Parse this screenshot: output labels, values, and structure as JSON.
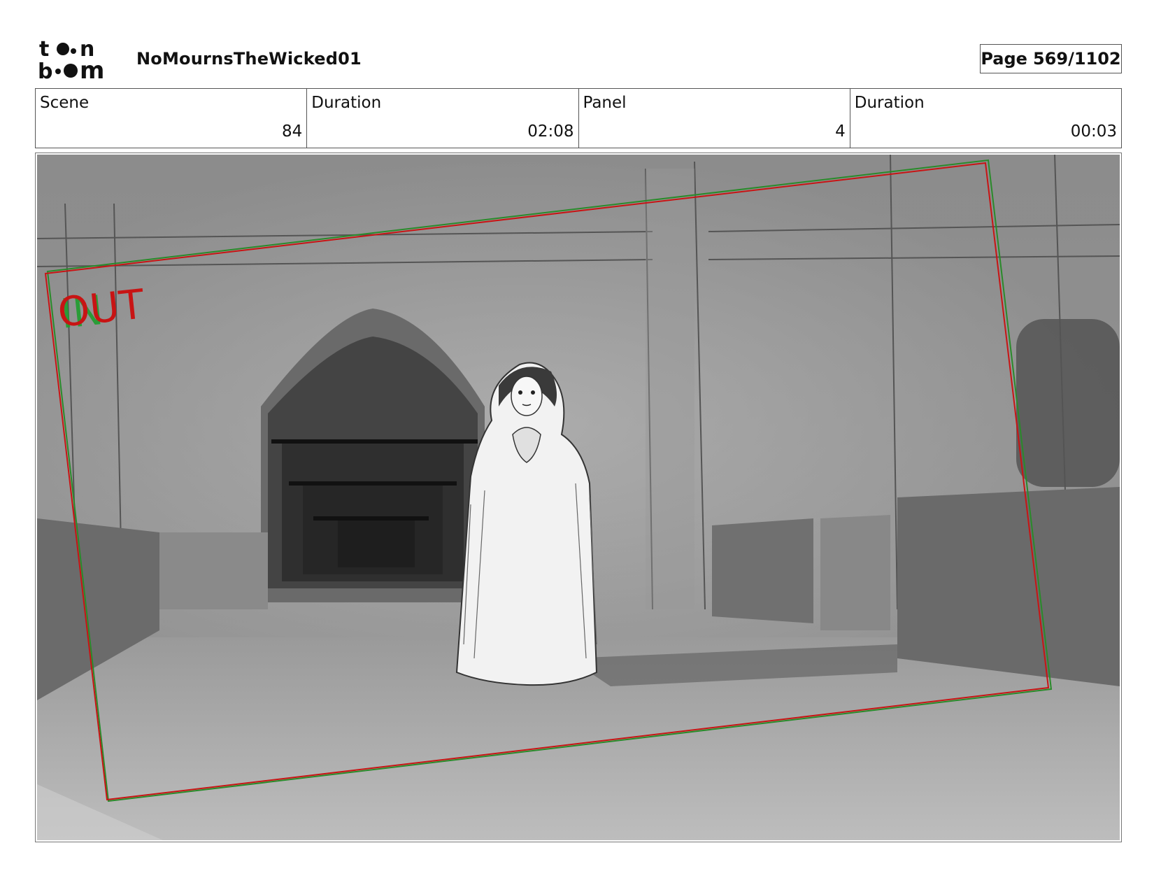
{
  "logo": {
    "brand": "toon boom",
    "line1": "t",
    "line1b": "n",
    "line2a": "b",
    "line2b": "m"
  },
  "header": {
    "project_title": "NoMournsTheWicked01",
    "page_label": "Page",
    "page_value": "569/1102"
  },
  "info": {
    "scene_label": "Scene",
    "scene_value": "84",
    "scene_duration_label": "Duration",
    "scene_duration_value": "02:08",
    "panel_label": "Panel",
    "panel_value": "4",
    "panel_duration_label": "Duration",
    "panel_duration_value": "00:03"
  },
  "panel": {
    "marker_in": "IN",
    "marker_out": "OUT",
    "in_color": "#1f9e2e",
    "out_color": "#c81414",
    "frame_color_red": "#c81414",
    "frame_color_green": "#2a8a2a"
  }
}
